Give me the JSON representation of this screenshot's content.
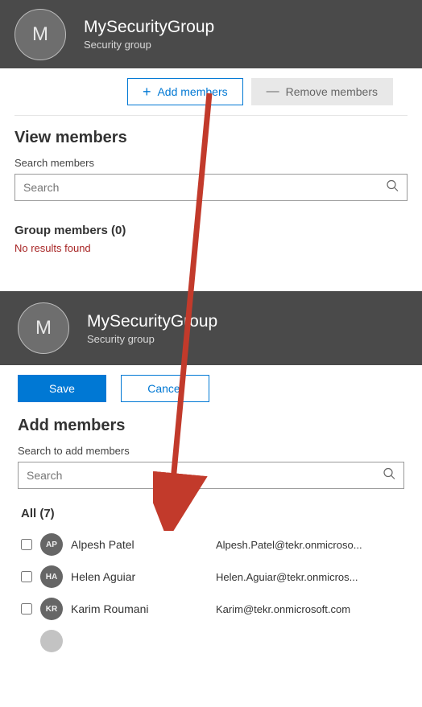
{
  "panel1": {
    "header": {
      "avatar_letter": "M",
      "title": "MySecurityGroup",
      "subtitle": "Security group"
    },
    "actions": {
      "add_label": "Add members",
      "remove_label": "Remove members"
    },
    "view_title": "View members",
    "search_label": "Search members",
    "search_placeholder": "Search",
    "group_members_heading": "Group members (0)",
    "no_results": "No results found"
  },
  "panel2": {
    "header": {
      "avatar_letter": "M",
      "title": "MySecurityGroup",
      "subtitle": "Security group"
    },
    "actions": {
      "save_label": "Save",
      "cancel_label": "Cancel"
    },
    "add_title": "Add members",
    "search_label": "Search to add members",
    "search_placeholder": "Search",
    "all_heading": "All (7)",
    "rows": [
      {
        "initials": "AP",
        "name": "Alpesh Patel",
        "email": "Alpesh.Patel@tekr.onmicroso..."
      },
      {
        "initials": "HA",
        "name": "Helen Aguiar",
        "email": "Helen.Aguiar@tekr.onmicros..."
      },
      {
        "initials": "KR",
        "name": "Karim Roumani",
        "email": "Karim@tekr.onmicrosoft.com"
      }
    ]
  }
}
